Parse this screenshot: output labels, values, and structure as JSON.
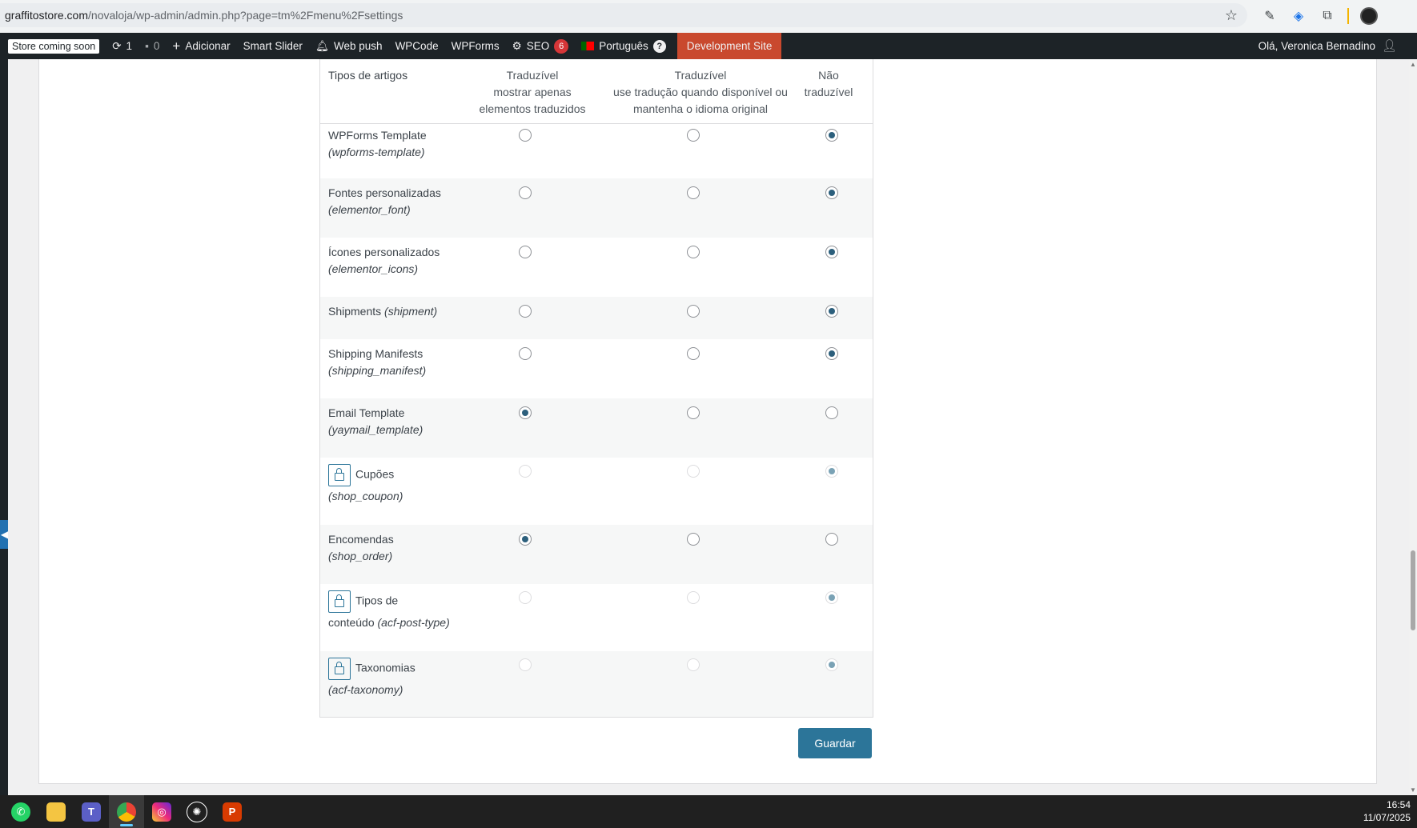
{
  "browser": {
    "url_domain": "graffitostore.com",
    "url_path": "/novaloja/wp-admin/admin.php?page=tm%2Fmenu%2Fsettings"
  },
  "adminbar": {
    "store_coming_soon": "Store coming soon",
    "updates_count": "1",
    "comments_count": "0",
    "add_new": "Adicionar",
    "smart_slider": "Smart Slider",
    "web_push": "Web push",
    "wpcode": "WPCode",
    "wpforms": "WPForms",
    "seo": "SEO",
    "seo_badge": "6",
    "language": "Português",
    "language_badge": "?",
    "dev_site": "Development Site",
    "greeting": "Olá, Veronica Bernadino"
  },
  "table": {
    "headers": {
      "type": "Tipos de artigos",
      "col1_title": "Traduzível",
      "col1_sub1": "mostrar apenas",
      "col1_sub2": "elementos traduzidos",
      "col2_title": "Traduzível",
      "col2_sub1": "use tradução quando disponível ou",
      "col2_sub2": "mantenha o idioma original",
      "col3_title1": "Não",
      "col3_title2": "traduzível"
    },
    "rows": [
      {
        "name": "WPForms Template",
        "slug": "(wpforms-template)",
        "locked": false,
        "selected": 3
      },
      {
        "name": "Fontes personalizadas",
        "slug": "(elementor_font)",
        "locked": false,
        "selected": 3
      },
      {
        "name": "Ícones personalizados",
        "slug": "(elementor_icons)",
        "locked": false,
        "selected": 3
      },
      {
        "name": "Shipments",
        "slug": "(shipment)",
        "locked": false,
        "selected": 3
      },
      {
        "name": "Shipping Manifests",
        "slug": "(shipping_manifest)",
        "locked": false,
        "selected": 3
      },
      {
        "name": "Email Template",
        "slug": "(yaymail_template)",
        "locked": false,
        "selected": 1
      },
      {
        "name": "Cupões",
        "slug": "(shop_coupon)",
        "locked": true,
        "selected": 3
      },
      {
        "name": "Encomendas",
        "slug": "(shop_order)",
        "locked": false,
        "selected": 1
      },
      {
        "name": "Tipos de",
        "name2": "conteúdo",
        "slug": "(acf-post-type)",
        "locked": true,
        "selected": 3
      },
      {
        "name": "Taxonomias",
        "slug": "(acf-taxonomy)",
        "locked": true,
        "selected": 3
      }
    ]
  },
  "save_button": "Guardar",
  "clock": {
    "time": "16:54",
    "date": "11/07/2025"
  }
}
